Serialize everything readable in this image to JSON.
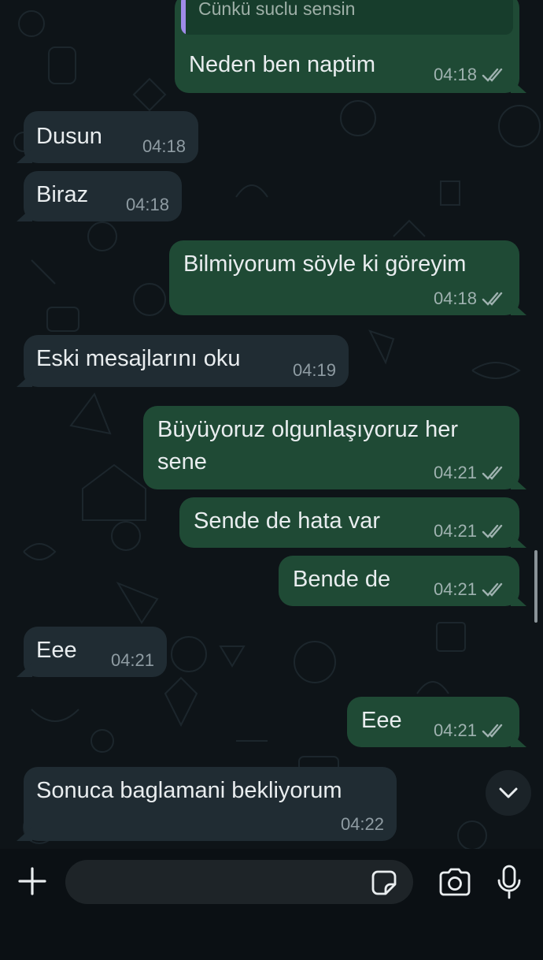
{
  "messages": [
    {
      "direction": "out",
      "quote": "Cünkü suclu sensin",
      "text": "Neden ben naptim",
      "time": "04:18",
      "status": "read"
    },
    {
      "direction": "in",
      "text": "Dusun",
      "time": "04:18"
    },
    {
      "direction": "in",
      "text": "Biraz",
      "time": "04:18"
    },
    {
      "direction": "out",
      "text": "Bilmiyorum söyle ki göreyim",
      "time": "04:18",
      "status": "read"
    },
    {
      "direction": "in",
      "text": "Eski mesajlarını oku",
      "time": "04:19"
    },
    {
      "direction": "out",
      "text_line1": "Büyüyoruz olgunlaşıyoruz her",
      "text_line2": "sene",
      "time": "04:21",
      "status": "read"
    },
    {
      "direction": "out",
      "text": "Sende de hata var",
      "time": "04:21",
      "status": "read"
    },
    {
      "direction": "out",
      "text": "Bende de",
      "time": "04:21",
      "status": "read"
    },
    {
      "direction": "in",
      "text": "Eee",
      "time": "04:21"
    },
    {
      "direction": "out",
      "text": "Eee",
      "time": "04:21",
      "status": "read"
    },
    {
      "direction": "in",
      "text": "Sonuca baglamani bekliyorum",
      "time": "04:22"
    }
  ],
  "composer": {
    "placeholder": "",
    "icons": [
      "plus-icon",
      "sticker-icon",
      "camera-icon",
      "microphone-icon"
    ]
  },
  "scroll_down_icon": "chevron-down-icon",
  "colors": {
    "chat_background": "#0e1418",
    "incoming_bubble": "#202c33",
    "outgoing_bubble": "#1f4a35",
    "read_ticks": "#9fb2b0",
    "quote_bar": "#9f8be8"
  }
}
